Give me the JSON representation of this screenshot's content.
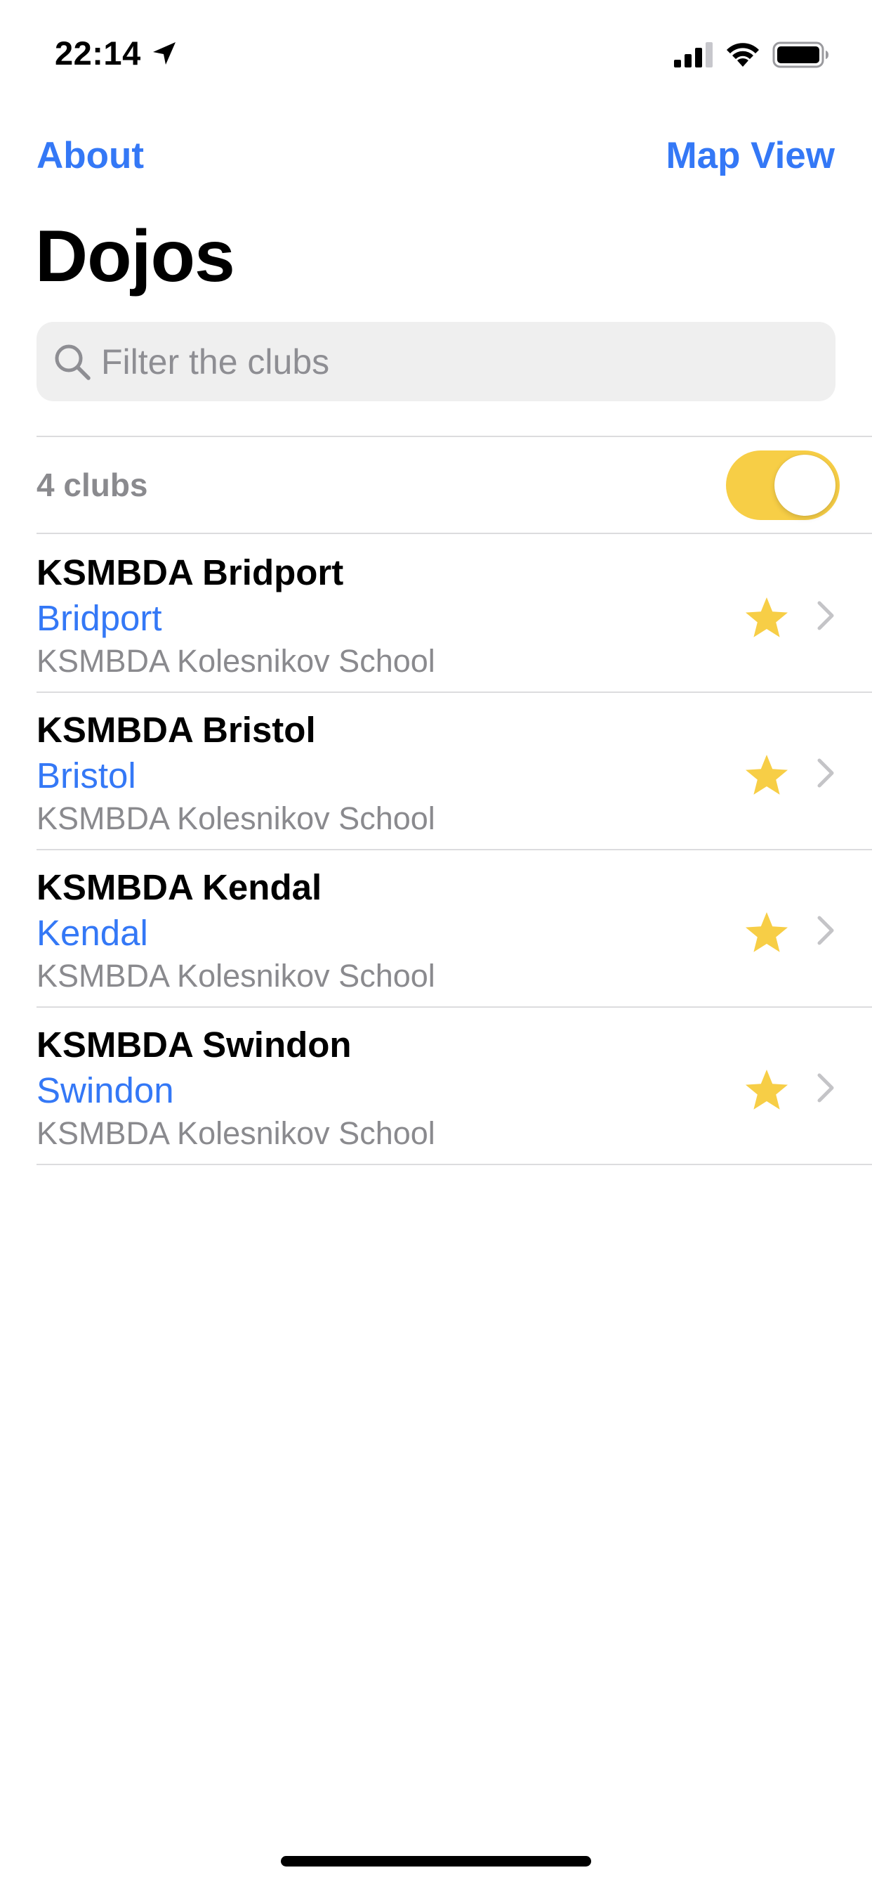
{
  "status_bar": {
    "time": "22:14"
  },
  "nav": {
    "left_label": "About",
    "right_label": "Map View",
    "title": "Dojos"
  },
  "search": {
    "placeholder": "Filter the clubs",
    "value": ""
  },
  "list": {
    "count_label": "4 clubs",
    "toggle_on": true,
    "clubs": [
      {
        "name": "KSMBDA Bridport",
        "city": "Bridport",
        "school": "KSMBDA Kolesnikov School",
        "favorite": true
      },
      {
        "name": "KSMBDA Bristol",
        "city": "Bristol",
        "school": "KSMBDA Kolesnikov School",
        "favorite": true
      },
      {
        "name": "KSMBDA Kendal",
        "city": "Kendal",
        "school": "KSMBDA Kolesnikov School",
        "favorite": true
      },
      {
        "name": "KSMBDA Swindon",
        "city": "Swindon",
        "school": "KSMBDA Kolesnikov School",
        "favorite": true
      }
    ]
  },
  "icons": {
    "location": "location-arrow-icon",
    "signal": "cellular-signal-icon",
    "wifi": "wifi-icon",
    "battery": "battery-icon",
    "search": "search-icon",
    "star": "star-icon",
    "chevron": "chevron-right-icon"
  },
  "colors": {
    "accent": "#3478f6",
    "star": "#f7ce46",
    "toggle_on": "#f7ce46",
    "secondary_text": "#8a8a8e"
  }
}
